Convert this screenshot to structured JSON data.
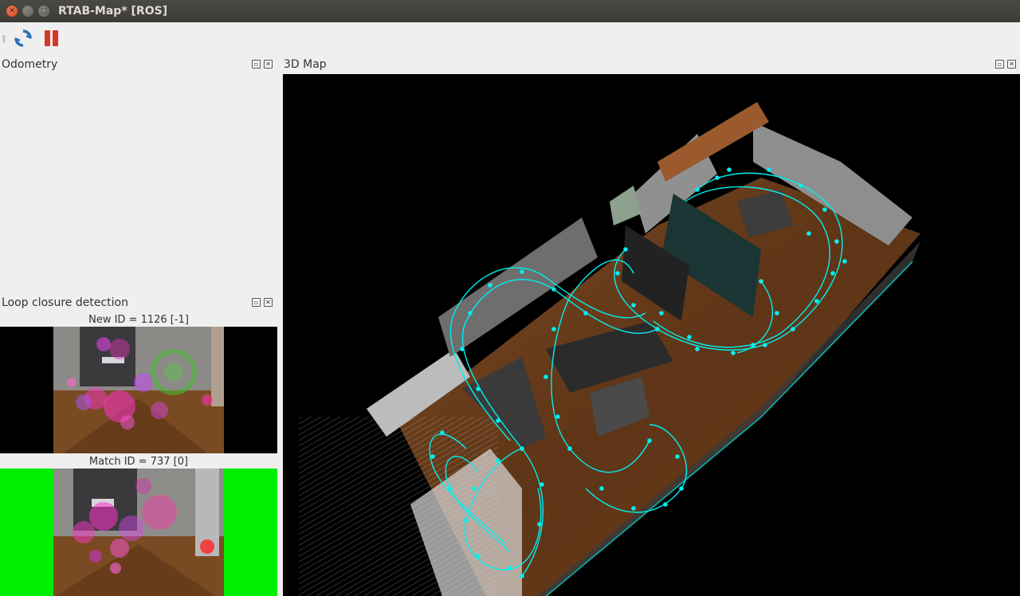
{
  "window": {
    "title": "RTAB-Map* [ROS]"
  },
  "toolbar": {
    "refresh_icon": "refresh-icon",
    "pause_icon": "pause-icon"
  },
  "docks": {
    "odometry": {
      "title": "Odometry"
    },
    "loop_closure": {
      "title": "Loop closure detection",
      "new_id_label": "New ID = 1126 [-1]",
      "match_id_label": "Match ID = 737 [0]"
    },
    "map3d": {
      "title": "3D Map"
    }
  },
  "colors": {
    "trajectory": "#00f0f0",
    "match_background": "#00ee00",
    "floor": "#6b3e1c"
  }
}
